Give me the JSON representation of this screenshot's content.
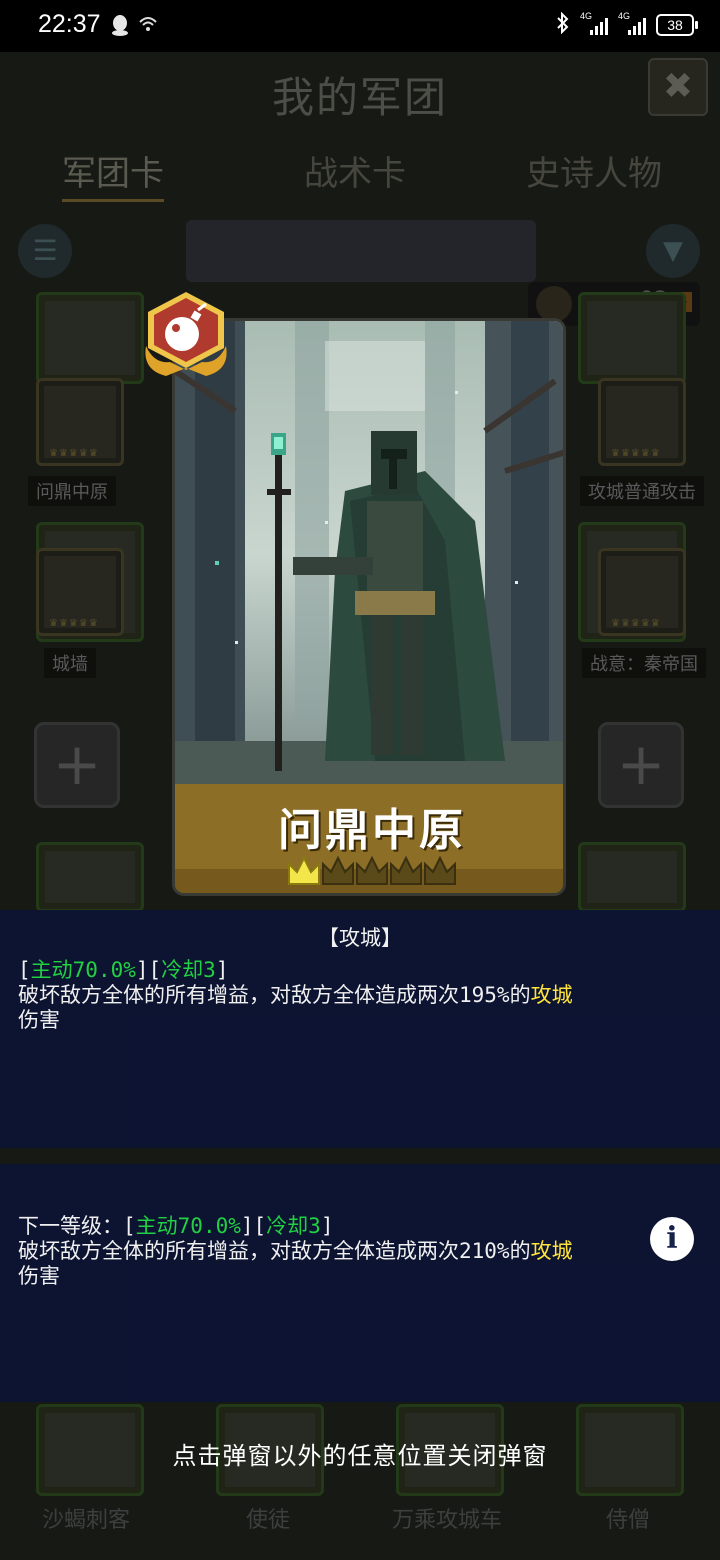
{
  "statusbar": {
    "time": "22:37",
    "battery": "38",
    "signal1_label": "4G",
    "signal2_label": "4G"
  },
  "background": {
    "title": "我的军团",
    "tabs": [
      "军团卡",
      "战术卡",
      "史诗人物"
    ],
    "count": "92",
    "cards": [
      {
        "label": "问鼎中原"
      },
      {
        "label": "城墙"
      },
      {
        "label": "攻城普通攻击"
      },
      {
        "label": "战意：秦帝国"
      }
    ],
    "bottom_cards": [
      "沙蝎刺客",
      "使徒",
      "万乘攻城车",
      "侍僧"
    ]
  },
  "card": {
    "name": "问鼎中原",
    "crowns_filled": 1,
    "crowns_total": 5
  },
  "skill": {
    "title": "【攻城】",
    "current": {
      "bracket_open": "[",
      "active": "主动70.0%",
      "mid": "][",
      "cooldown": "冷却3",
      "bracket_close": "]",
      "text": "破坏敌方全体的所有增益，对敌方全体造成两次195%的",
      "keyword": "攻城",
      "tail": "伤害"
    },
    "next": {
      "prefix": "下一等级：[",
      "active": "主动70.0%",
      "mid": "][",
      "cooldown": "冷却3",
      "bracket_close": "]",
      "text": "破坏敌方全体的所有增益，对敌方全体造成两次210%的",
      "keyword": "攻城",
      "tail": "伤害"
    }
  },
  "hint": "点击弹窗以外的任意位置关闭弹窗",
  "colors": {
    "panel": "#0d1434",
    "active_green": "#22d043",
    "keyword_yellow": "#ffe53a",
    "banner_gold": "#8c6e27"
  }
}
